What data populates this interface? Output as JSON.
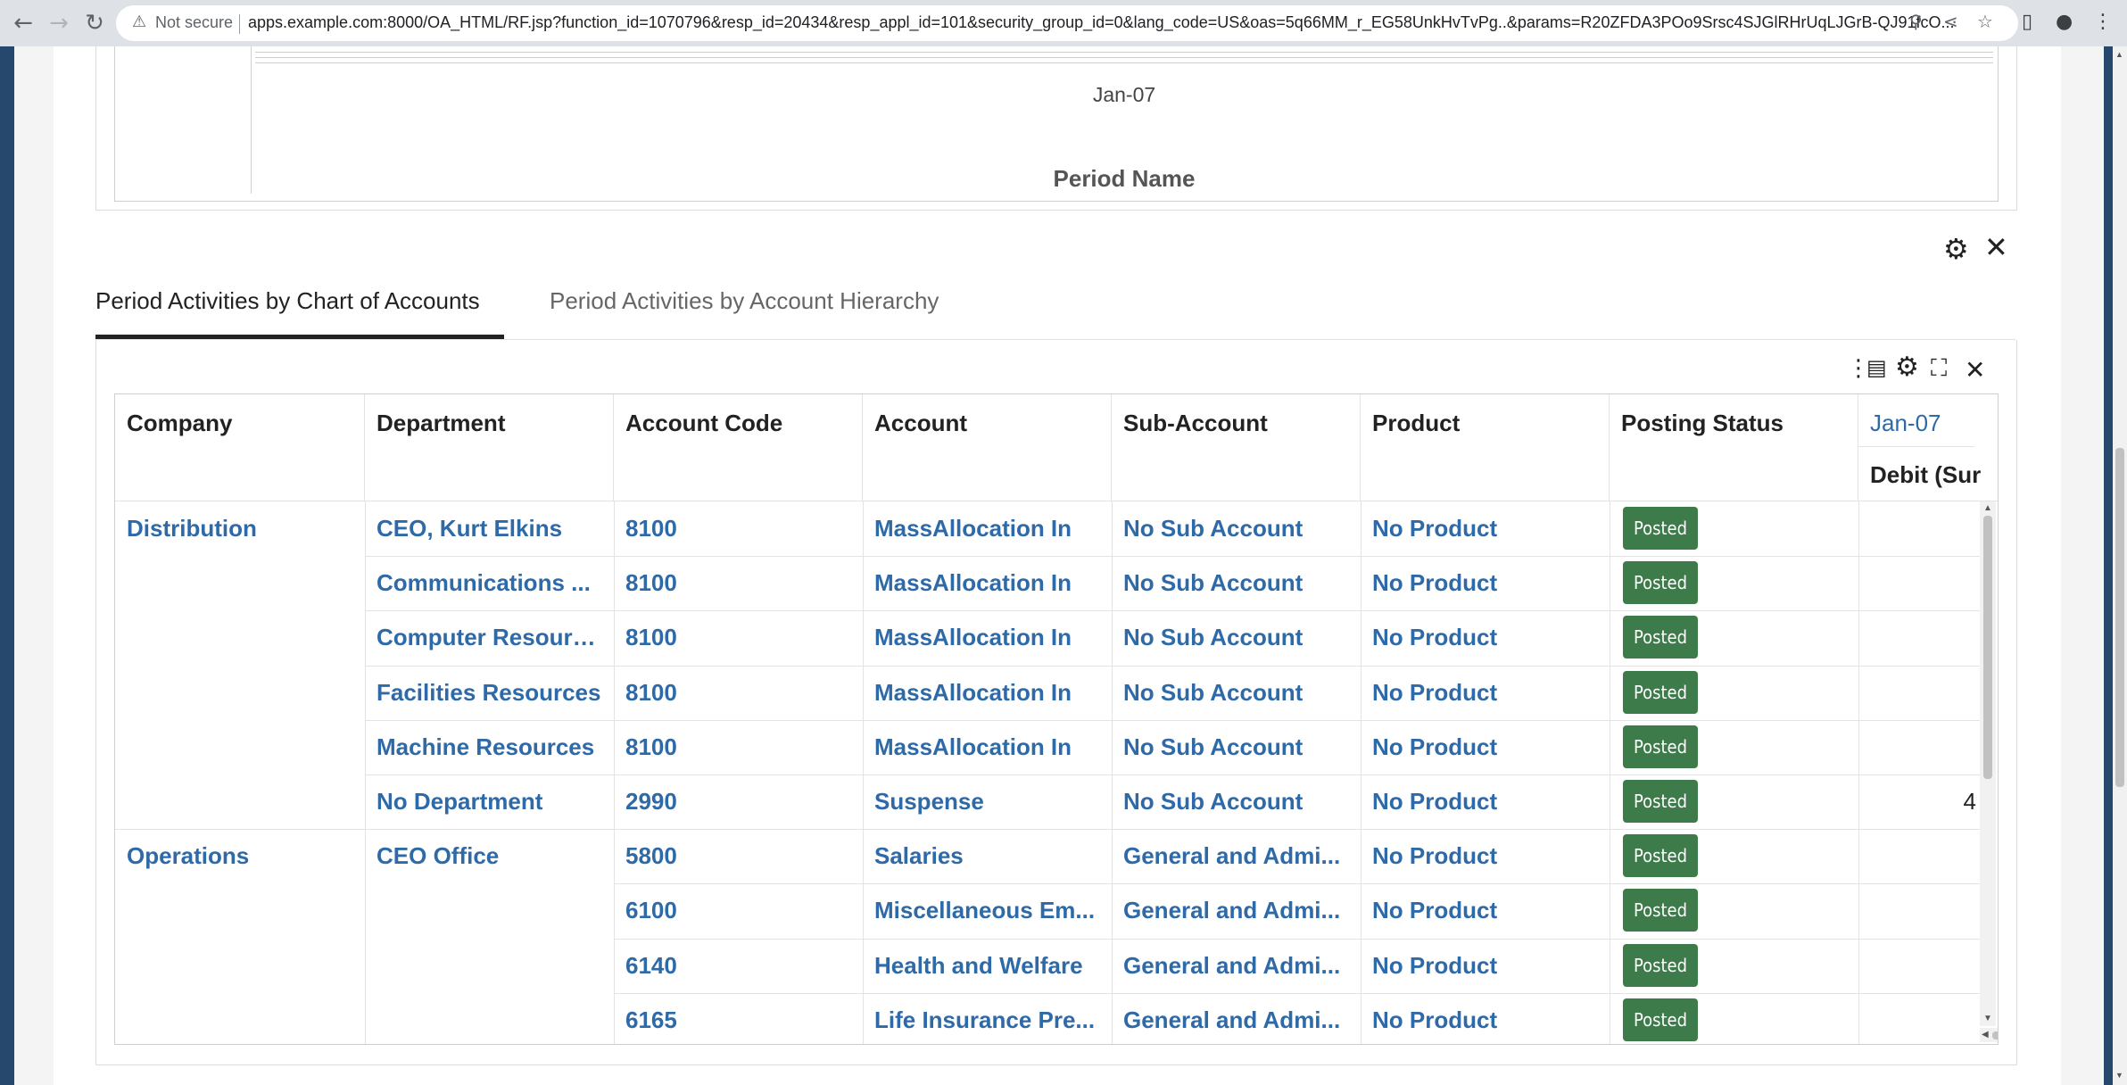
{
  "browser": {
    "security_label": "Not secure",
    "url": "apps.example.com:8000/OA_HTML/RF.jsp?function_id=1070796&resp_id=20434&resp_appl_id=101&security_group_id=0&lang_code=US&oas=5q66MM_r_EG58UnkHvTvPg..&params=R20ZFDA3POo9Srsc4SJGlRHrUqLJGrB-QJ91fcO..."
  },
  "chart_region": {
    "period_value": "Jan-07",
    "axis_title": "Period Name"
  },
  "tabs": [
    {
      "label": "Period Activities by Chart of Accounts",
      "active": true
    },
    {
      "label": "Period Activities by Account Hierarchy",
      "active": false
    }
  ],
  "table": {
    "columns": [
      "Company",
      "Department",
      "Account Code",
      "Account",
      "Sub-Account",
      "Product",
      "Posting Status"
    ],
    "period_column": {
      "label": "Jan-07",
      "sub_label": "Debit (Sur"
    },
    "rows": [
      {
        "company": "Distribution",
        "department": "CEO, Kurt Elkins",
        "account_code": "8100",
        "account": "MassAllocation In",
        "sub_account": "No Sub Account",
        "product": "No Product",
        "status": "Posted",
        "debit": ""
      },
      {
        "company": "",
        "department": "Communications ...",
        "account_code": "8100",
        "account": "MassAllocation In",
        "sub_account": "No Sub Account",
        "product": "No Product",
        "status": "Posted",
        "debit": ""
      },
      {
        "company": "",
        "department": "Computer Resources",
        "account_code": "8100",
        "account": "MassAllocation In",
        "sub_account": "No Sub Account",
        "product": "No Product",
        "status": "Posted",
        "debit": ""
      },
      {
        "company": "",
        "department": "Facilities Resources",
        "account_code": "8100",
        "account": "MassAllocation In",
        "sub_account": "No Sub Account",
        "product": "No Product",
        "status": "Posted",
        "debit": ""
      },
      {
        "company": "",
        "department": "Machine Resources",
        "account_code": "8100",
        "account": "MassAllocation In",
        "sub_account": "No Sub Account",
        "product": "No Product",
        "status": "Posted",
        "debit": ""
      },
      {
        "company": "",
        "department": "No Department",
        "account_code": "2990",
        "account": "Suspense",
        "sub_account": "No Sub Account",
        "product": "No Product",
        "status": "Posted",
        "debit": "4"
      },
      {
        "company": "Operations",
        "department": "CEO Office",
        "account_code": "5800",
        "account": "Salaries",
        "sub_account": "General and Admi...",
        "product": "No Product",
        "status": "Posted",
        "debit": ""
      },
      {
        "company": "",
        "department": "",
        "account_code": "6100",
        "account": "Miscellaneous Em...",
        "sub_account": "General and Admi...",
        "product": "No Product",
        "status": "Posted",
        "debit": ""
      },
      {
        "company": "",
        "department": "",
        "account_code": "6140",
        "account": "Health and Welfare",
        "sub_account": "General and Admi...",
        "product": "No Product",
        "status": "Posted",
        "debit": ""
      },
      {
        "company": "",
        "department": "",
        "account_code": "6165",
        "account": "Life Insurance Pre...",
        "sub_account": "General and Admi...",
        "product": "No Product",
        "status": "Posted",
        "debit": ""
      }
    ]
  },
  "colors": {
    "link": "#2f6aa8",
    "badge": "#3e7b4a",
    "frame": "#27486d"
  }
}
